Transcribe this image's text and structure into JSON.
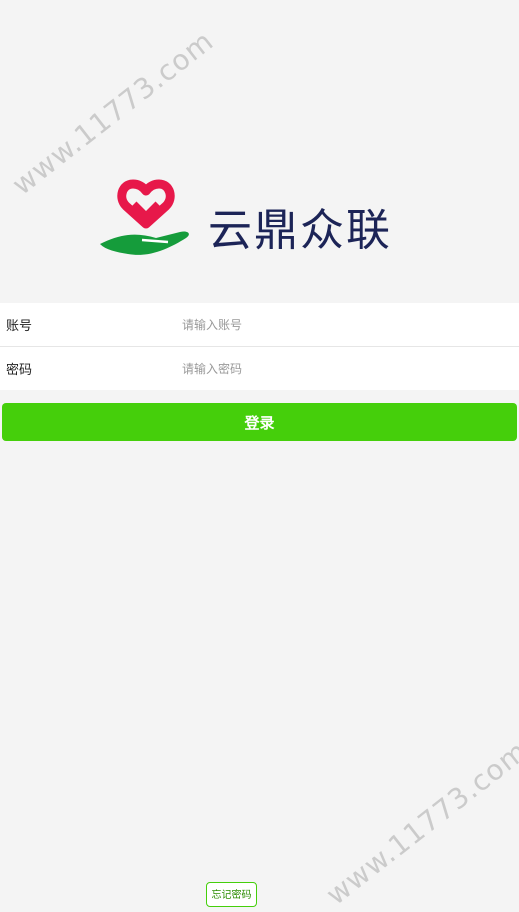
{
  "brand": {
    "name": "云鼎众联",
    "logo": "heart-hand-logo",
    "heart_color": "#e7184a",
    "hand_color": "#159c3b",
    "name_color": "#1c2457"
  },
  "form": {
    "account_label": "账号",
    "account_placeholder": "请输入账号",
    "password_label": "密码",
    "password_placeholder": "请输入密码"
  },
  "login_button": {
    "label": "登录",
    "color": "#45cf0b"
  },
  "forgot_password": {
    "label": "忘记密码"
  },
  "watermark": {
    "text": "www.11773.com"
  }
}
